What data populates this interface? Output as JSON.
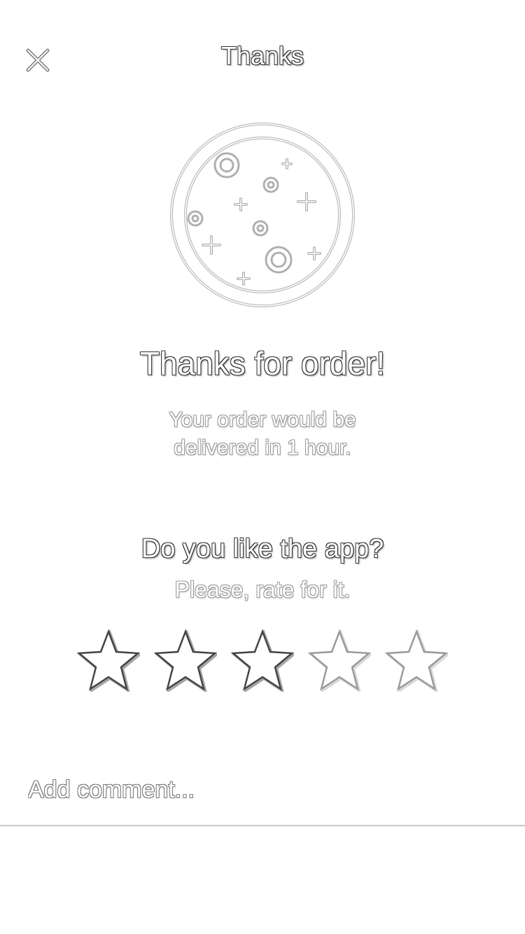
{
  "header": {
    "title": "Thanks",
    "close_icon": "close-icon"
  },
  "illustration": {
    "icon": "plate-with-dots-icon"
  },
  "confirmation": {
    "headline": "Thanks for order!",
    "line1": "Your order would be",
    "line2": "delivered in 1 hour."
  },
  "rating": {
    "question": "Do you like the app?",
    "prompt": "Please, rate for it.",
    "value": 3,
    "max": 5,
    "star_icon": "star-icon"
  },
  "comment": {
    "placeholder": "Add comment..."
  }
}
